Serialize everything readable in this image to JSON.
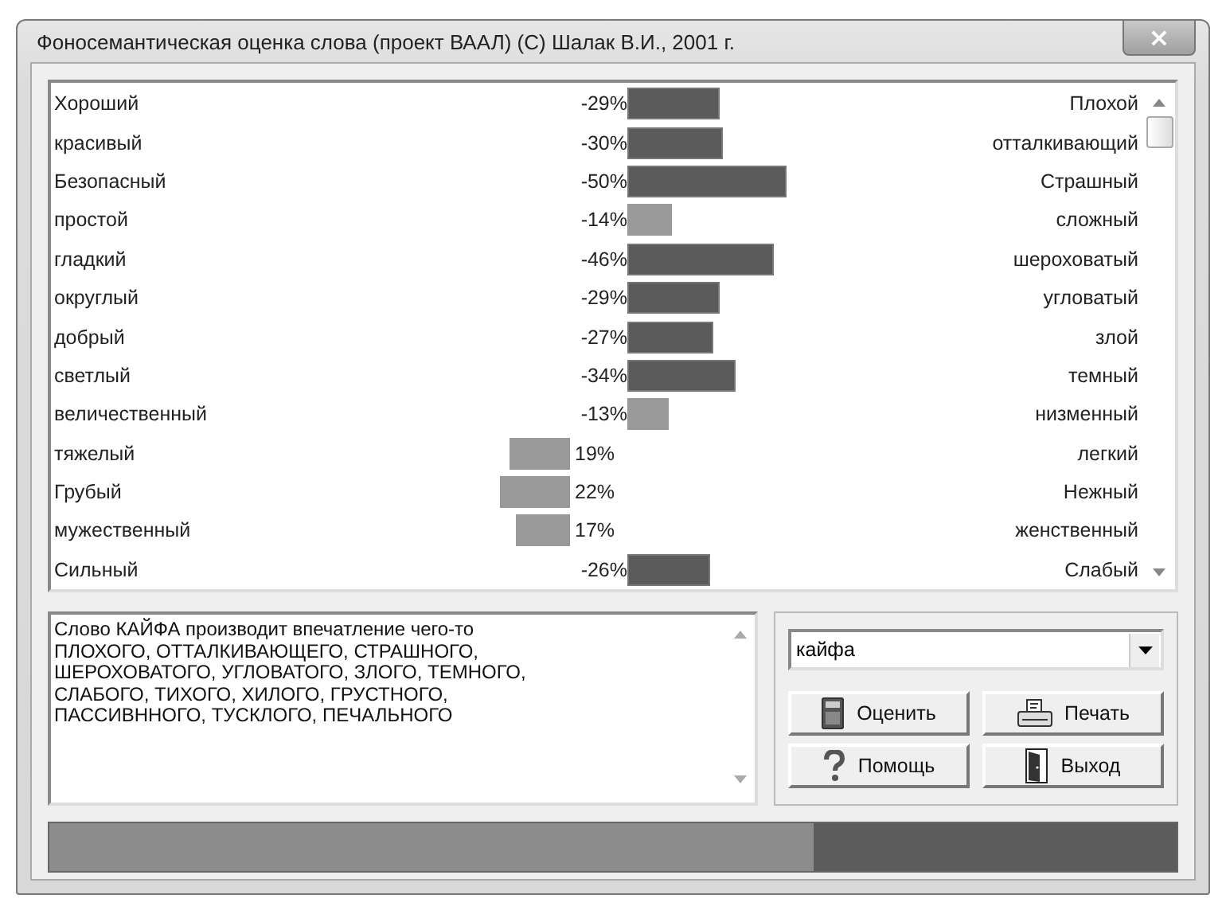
{
  "window": {
    "title": "Фоносемантическая оценка слова  (проект ВААЛ)  (С) Шалак В.И., 2001 г.",
    "close": "×"
  },
  "scales": [
    {
      "left": "Хороший",
      "value": "-29%",
      "right": "Плохой",
      "kind": "negative",
      "strong": true
    },
    {
      "left": "красивый",
      "value": "-30%",
      "right": "отталкивающий",
      "kind": "negative",
      "strong": true
    },
    {
      "left": "Безопасный",
      "value": "-50%",
      "right": "Страшный",
      "kind": "negative",
      "strong": true
    },
    {
      "left": "простой",
      "value": "-14%",
      "right": "сложный",
      "kind": "negative",
      "strong": false
    },
    {
      "left": "гладкий",
      "value": "-46%",
      "right": "шероховатый",
      "kind": "negative",
      "strong": true
    },
    {
      "left": "округлый",
      "value": "-29%",
      "right": "угловатый",
      "kind": "negative",
      "strong": true
    },
    {
      "left": "добрый",
      "value": "-27%",
      "right": "злой",
      "kind": "negative",
      "strong": true
    },
    {
      "left": "светлый",
      "value": "-34%",
      "right": "темный",
      "kind": "negative",
      "strong": true
    },
    {
      "left": "величественный",
      "value": "-13%",
      "right": "низменный",
      "kind": "negative",
      "strong": false
    },
    {
      "left": "тяжелый",
      "value": "19%",
      "right": "легкий",
      "kind": "positive",
      "strong": false
    },
    {
      "left": "Грубый",
      "value": "22%",
      "right": "Нежный",
      "kind": "positive",
      "strong": false
    },
    {
      "left": "мужественный",
      "value": "17%",
      "right": "женственный",
      "kind": "positive",
      "strong": false
    },
    {
      "left": "Сильный",
      "value": "-26%",
      "right": "Слабый",
      "kind": "negative",
      "strong": true
    }
  ],
  "result_text": "Слово КАЙФА производит впечатление чего-то\nПЛОХОГО, ОТТАЛКИВАЮЩЕГО, СТРАШНОГО,\nШЕРОХОВАТОГО, УГЛОВАТОГО, ЗЛОГО, ТЕМНОГО,\nСЛАБОГО, ТИХОГО, ХИЛОГО, ГРУСТНОГО,\nПАССИВННОГО, ТУСКЛОГО, ПЕЧАЛЬНОГО",
  "word_field": {
    "value": "кайфа"
  },
  "buttons": [
    {
      "kind": "evaluate",
      "label": "Оценить"
    },
    {
      "kind": "print",
      "label": "Печать"
    },
    {
      "kind": "help",
      "label": "Помощь"
    },
    {
      "kind": "exit",
      "label": "Выход"
    }
  ]
}
